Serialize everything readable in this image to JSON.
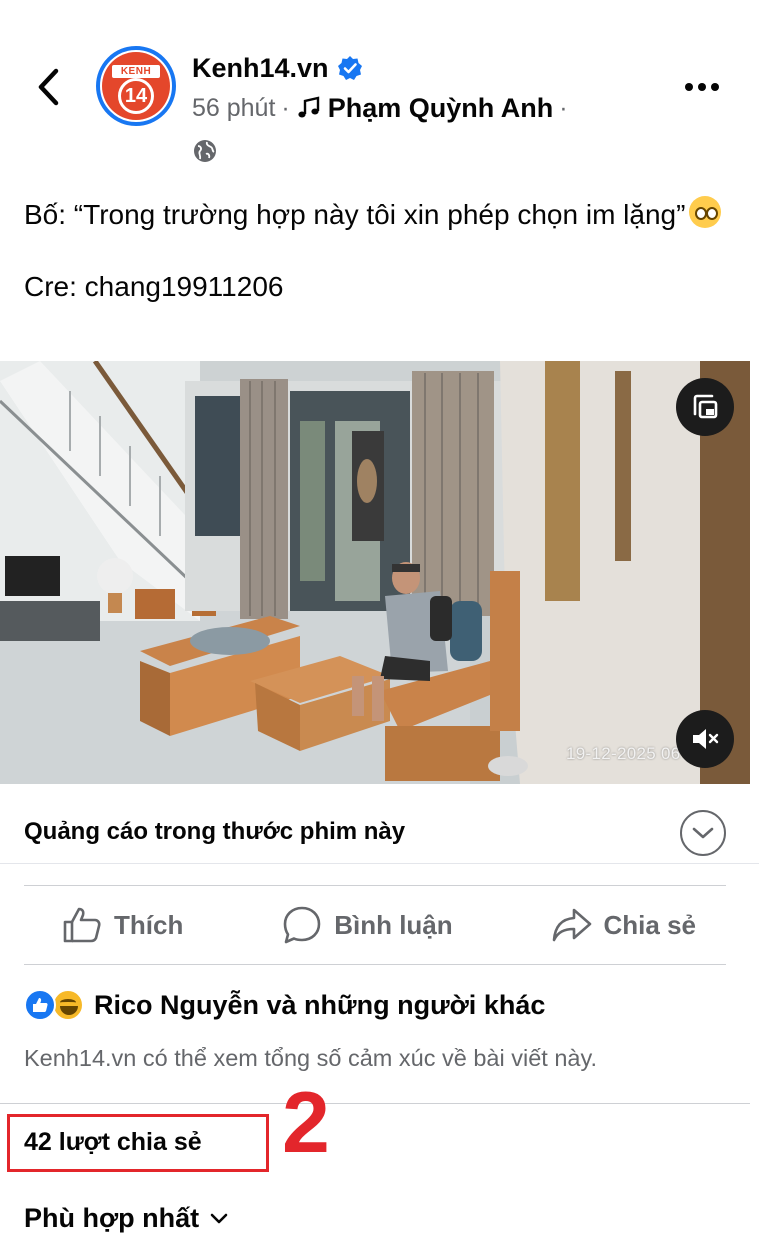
{
  "post_header": {
    "page_name": "Kenh14.vn",
    "time": "56 phút",
    "separator": "·",
    "song_artist": "Phạm Quỳnh Anh",
    "trailing_separator": "·",
    "avatar_text_top": "KENH",
    "avatar_text_num": "14"
  },
  "caption": {
    "line1": "Bố: “Trong trường hợp này tôi xin phép chọn im lặng”",
    "line2": "Cre: chang19911206"
  },
  "video": {
    "timestamp": "19-12-2025 06",
    "watermark": "im"
  },
  "ads": {
    "label": "Quảng cáo trong thước phim này"
  },
  "actions": {
    "like": "Thích",
    "comment": "Bình luận",
    "share": "Chia sẻ"
  },
  "reactions": {
    "text": "Rico Nguyễn và những người khác",
    "notice": "Kenh14.vn có thể xem tổng số cảm xúc về bài viết này."
  },
  "shares": {
    "text": "42 lượt chia sẻ"
  },
  "annotation": {
    "number": "2",
    "color": "#e3262b"
  },
  "sort": {
    "label": "Phù hợp nhất"
  },
  "colors": {
    "accent": "#1877f2",
    "secondary_text": "#65676b"
  }
}
